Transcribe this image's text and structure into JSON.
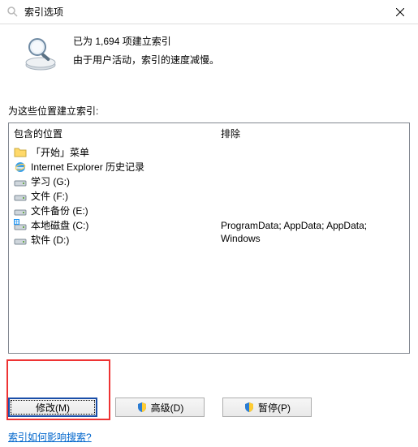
{
  "window": {
    "title": "索引选项"
  },
  "summary": {
    "line1": "已为 1,694 项建立索引",
    "line2": "由于用户活动，索引的速度减慢。"
  },
  "section_label": "为这些位置建立索引:",
  "columns": {
    "included": "包含的位置",
    "excluded": "排除"
  },
  "locations": [
    {
      "icon": "folder",
      "label": "「开始」菜单",
      "exclude": ""
    },
    {
      "icon": "ie",
      "label": "Internet Explorer 历史记录",
      "exclude": ""
    },
    {
      "icon": "drive",
      "label": "学习 (G:)",
      "exclude": ""
    },
    {
      "icon": "drive",
      "label": "文件 (F:)",
      "exclude": ""
    },
    {
      "icon": "drive",
      "label": "文件备份 (E:)",
      "exclude": ""
    },
    {
      "icon": "drive-sys",
      "label": "本地磁盘 (C:)",
      "exclude": "ProgramData; AppData; AppData; Windows"
    },
    {
      "icon": "drive",
      "label": "软件 (D:)",
      "exclude": ""
    }
  ],
  "buttons": {
    "modify": "修改(M)",
    "advanced": "高级(D)",
    "pause": "暂停(P)"
  },
  "help_link": "索引如何影响搜索?"
}
